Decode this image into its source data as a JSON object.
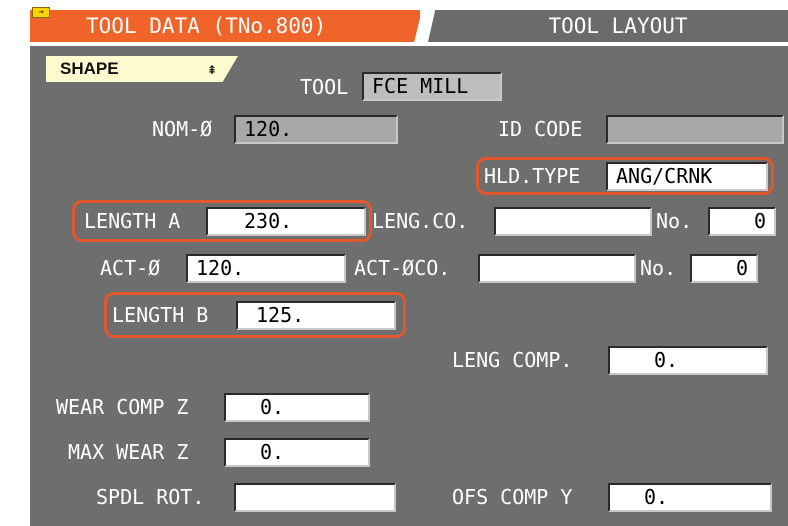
{
  "tabs": {
    "active_label": "TOOL DATA (TNo.800)",
    "inactive_label": "TOOL LAYOUT"
  },
  "section": {
    "label": "SHAPE",
    "chevron": "⇞"
  },
  "fields": {
    "tool": {
      "label": "TOOL",
      "value": "FCE MILL"
    },
    "nom_dia": {
      "label": "NOM-Ø",
      "value": "120."
    },
    "id_code": {
      "label": "ID CODE",
      "value": ""
    },
    "hld_type": {
      "label": "HLD.TYPE",
      "value": "ANG/CRNK"
    },
    "length_a": {
      "label": "LENGTH A",
      "value": "230."
    },
    "leng_co": {
      "label": "LENG.CO.",
      "value": ""
    },
    "no1": {
      "label": "No.",
      "value": "0"
    },
    "act_dia": {
      "label": "ACT-Ø",
      "value": "120."
    },
    "act_dia_co": {
      "label": "ACT-ØCO.",
      "value": ""
    },
    "no2": {
      "label": "No.",
      "value": "0"
    },
    "length_b": {
      "label": "LENGTH B",
      "value": "125."
    },
    "leng_comp": {
      "label": "LENG COMP.",
      "value": "0."
    },
    "wear_comp_z": {
      "label": "WEAR COMP Z",
      "value": "0."
    },
    "max_wear_z": {
      "label": "MAX WEAR Z",
      "value": "0."
    },
    "spdl_rot": {
      "label": "SPDL ROT.",
      "value": ""
    },
    "ofs_comp_y": {
      "label": "OFS COMP Y",
      "value": "0."
    }
  },
  "colors": {
    "active_tab": "#f0642a",
    "inactive_tab": "#6b6b6b",
    "panel": "#6e6e6e",
    "highlight": "#e2582a",
    "shape_tab": "#fbfbcf"
  },
  "icons": {
    "tab_marker": "marker-icon",
    "collapse": "chevron-up-double-icon"
  }
}
